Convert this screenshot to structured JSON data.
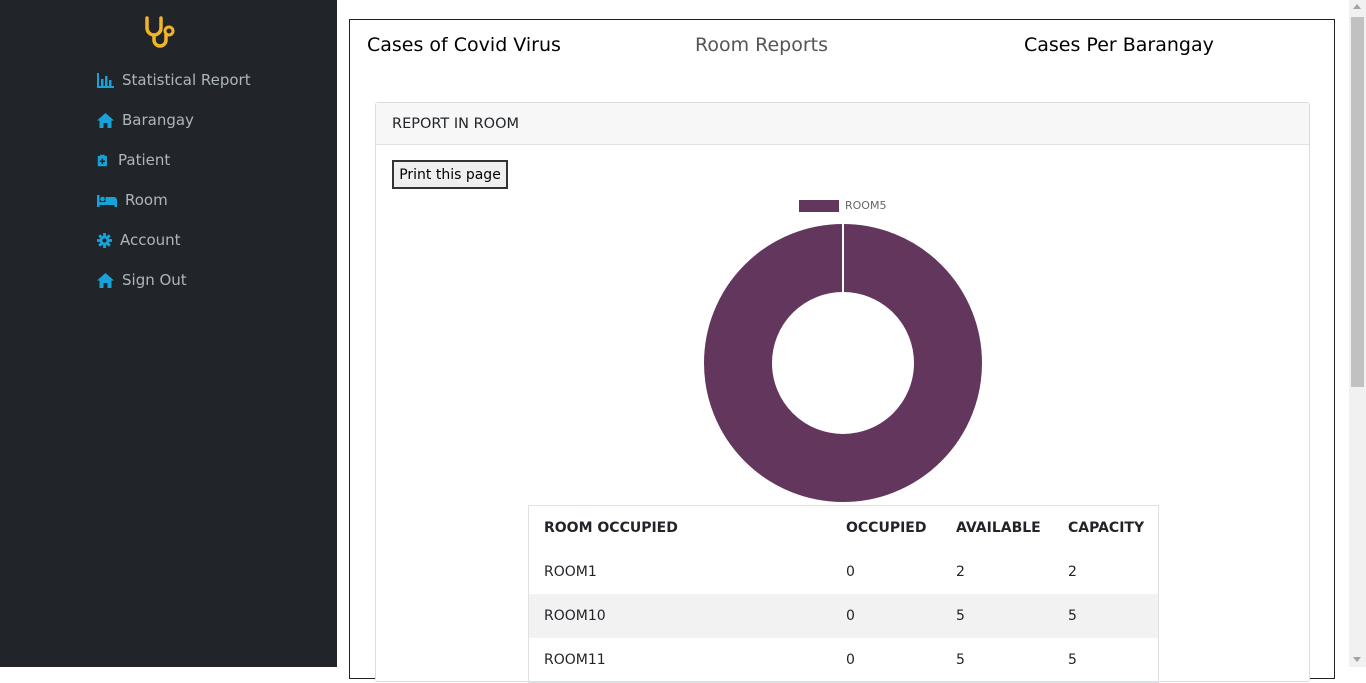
{
  "sidebar": {
    "logo_icon": "stethoscope-icon",
    "items": [
      {
        "label": "Statistical Report",
        "icon": "bar-chart-icon"
      },
      {
        "label": "Barangay",
        "icon": "home-icon"
      },
      {
        "label": "Patient",
        "icon": "medical-clipboard-icon"
      },
      {
        "label": "Room",
        "icon": "bed-icon"
      },
      {
        "label": "Account",
        "icon": "gear-icon"
      },
      {
        "label": "Sign Out",
        "icon": "home-icon"
      }
    ]
  },
  "topnav": {
    "cases_covid": "Cases of Covid Virus",
    "room_reports": "Room Reports",
    "cases_barangay": "Cases Per Barangay"
  },
  "card": {
    "header": "REPORT IN ROOM",
    "print_button": "Print this page"
  },
  "chart_data": {
    "type": "pie",
    "variant": "doughnut",
    "legend_position": "top",
    "labels": [
      "ROOM5"
    ],
    "values": [
      1
    ],
    "colors": [
      "#63365e"
    ]
  },
  "table": {
    "columns": [
      "ROOM OCCUPIED",
      "OCCUPIED",
      "AVAILABLE",
      "CAPACITY"
    ],
    "rows": [
      [
        "ROOM1",
        "0",
        "2",
        "2"
      ],
      [
        "ROOM10",
        "0",
        "5",
        "5"
      ],
      [
        "ROOM11",
        "0",
        "5",
        "5"
      ]
    ]
  },
  "colors": {
    "sidebar_bg": "#212529",
    "icon_accent": "#17a2d8",
    "logo_accent": "#f0b429",
    "chart_slice": "#63365e"
  }
}
